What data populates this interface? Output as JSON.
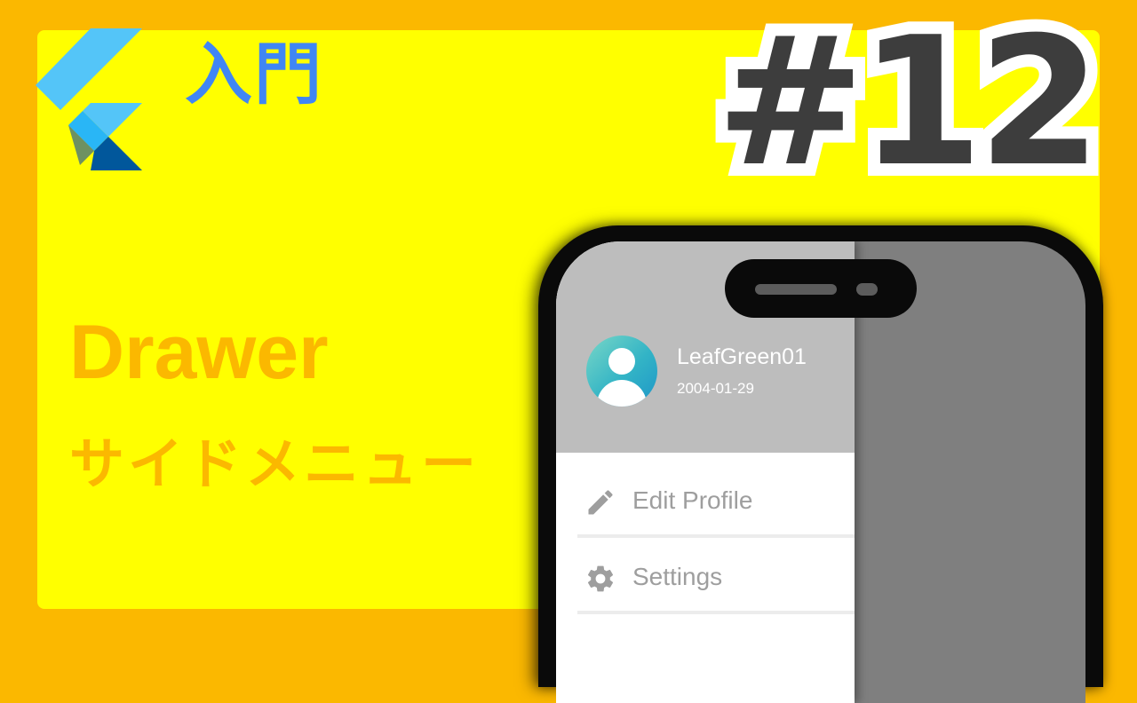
{
  "intro": {
    "title": "入門"
  },
  "episode": {
    "number": "#12"
  },
  "topic": {
    "title": "Drawer",
    "subtitle": "サイドメニュー"
  },
  "drawer": {
    "user": {
      "name": "LeafGreen01",
      "date": "2004-01-29"
    },
    "items": [
      {
        "label": "Edit Profile",
        "icon": "pencil-icon"
      },
      {
        "label": "Settings",
        "icon": "gear-icon"
      }
    ]
  },
  "colors": {
    "background": "#fbb800",
    "panel": "#ffff00",
    "intro_text": "#4086f4",
    "episode_text": "#3d3d3d",
    "topic_text": "#fbb800",
    "drawer_header": "#bdbdbd",
    "scrim": "#7f7f7f"
  }
}
